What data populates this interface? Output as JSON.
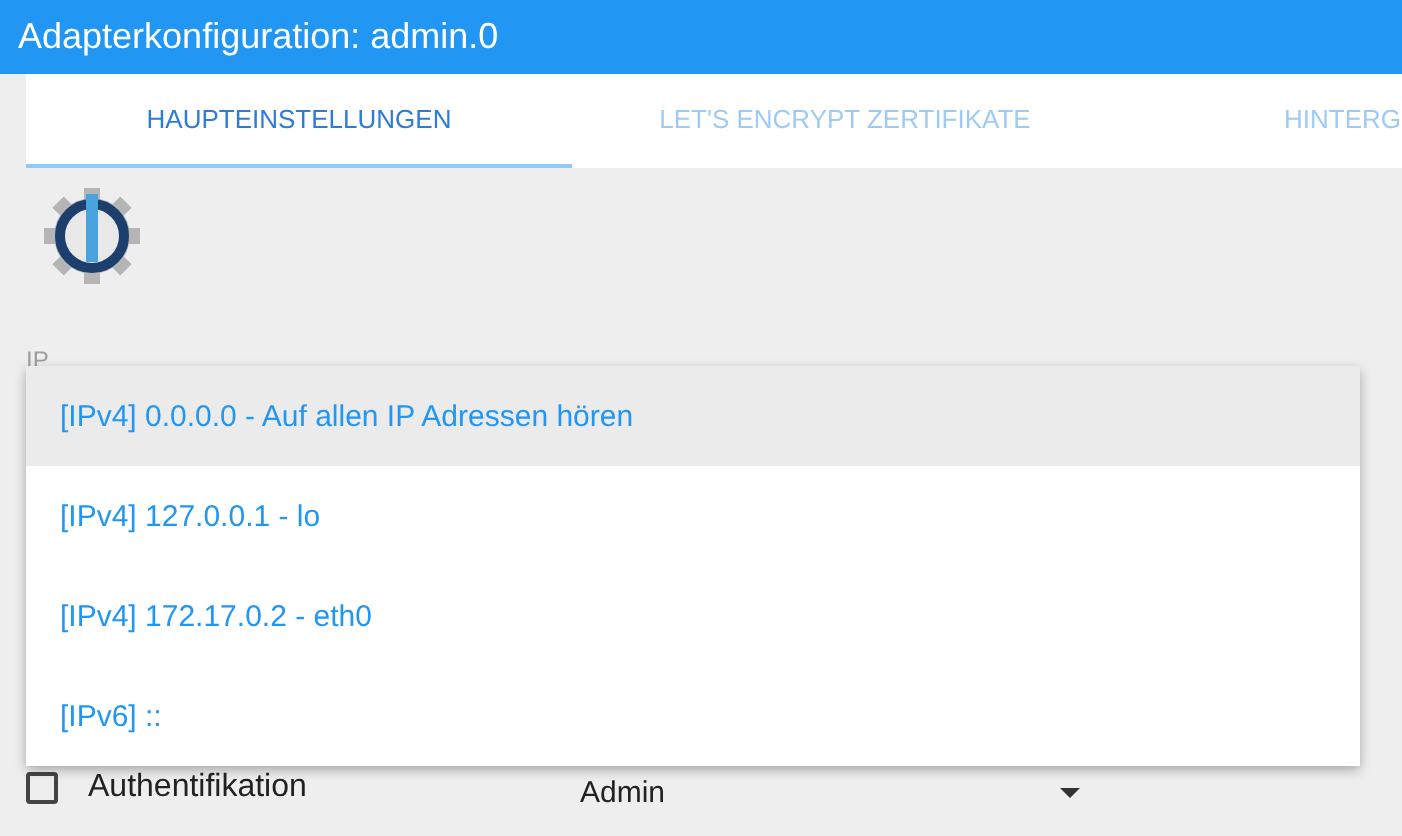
{
  "window": {
    "title": "Adapterkonfiguration: admin.0"
  },
  "tabs": [
    {
      "label": "HAUPTEINSTELLUNGEN",
      "selected": true
    },
    {
      "label": "LET'S ENCRYPT ZERTIFIKATE",
      "selected": false
    },
    {
      "label": "HINTERG",
      "selected": false
    }
  ],
  "ip_field": {
    "label": "IP"
  },
  "ip_menu": [
    {
      "label": "[IPv4] 0.0.0.0 - Auf allen IP Adressen hören",
      "selected": true
    },
    {
      "label": "[IPv4] 127.0.0.1 - lo",
      "selected": false
    },
    {
      "label": "[IPv4] 172.17.0.2 - eth0",
      "selected": false
    },
    {
      "label": "[IPv6] ::",
      "selected": false
    }
  ],
  "auth": {
    "label": "Authentifikation",
    "checked": false
  },
  "user_select": {
    "value": "Admin"
  }
}
